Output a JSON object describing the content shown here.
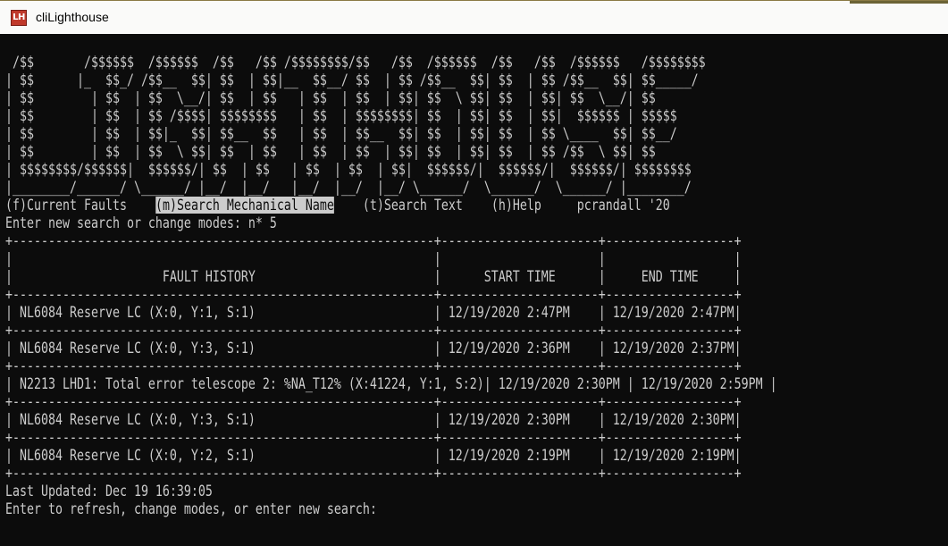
{
  "window": {
    "title": "cliLighthouse",
    "icon_label": "LH"
  },
  "banner": [
    " /$$       /$$$$$$  /$$$$$$  /$$   /$$ /$$$$$$$$/$$   /$$  /$$$$$$  /$$   /$$  /$$$$$$   /$$$$$$$$",
    "| $$      |_  $$_/ /$$__  $$| $$  | $$|__  $$__/ $$  | $$ /$$__  $$| $$  | $$ /$$__  $$| $$_____/",
    "| $$        | $$  | $$  \\__/| $$  | $$   | $$  | $$  | $$| $$  \\ $$| $$  | $$| $$  \\__/| $$",
    "| $$        | $$  | $$ /$$$$| $$$$$$$$   | $$  | $$$$$$$$| $$  | $$| $$  | $$|  $$$$$$ | $$$$$",
    "| $$        | $$  | $$|_  $$| $$__  $$   | $$  | $$__  $$| $$  | $$| $$  | $$ \\____  $$| $$__/",
    "| $$        | $$  | $$  \\ $$| $$  | $$   | $$  | $$  | $$| $$  | $$| $$  | $$ /$$  \\ $$| $$",
    "| $$$$$$$$/$$$$$$|  $$$$$$/| $$  | $$   | $$  | $$  | $$|  $$$$$$/|  $$$$$$/|  $$$$$$/| $$$$$$$$",
    "|________/______/ \\______/ |__/  |__/   |__/  |__/  |__/ \\______/  \\______/  \\______/ |________/"
  ],
  "menu": {
    "current_faults": "(f)Current Faults",
    "gap_1": "    ",
    "search_mechanical": "(m)Search Mechanical Name",
    "gap_2": "    ",
    "search_text": "(t)Search Text",
    "gap_3": "    ",
    "help": "(h)Help",
    "gap_4": "     ",
    "author": "pcrandall '20"
  },
  "prompt": {
    "label": "Enter new search or change modes: ",
    "value": "n* 5"
  },
  "table": {
    "border": "+-----------------------------------------------------------+----------------------+------------------+",
    "header_blank": "|                                                           |                      |                  |",
    "header_row": "|                     FAULT HISTORY                         |      START TIME      |     END TIME     |",
    "rows": [
      "| NL6084 Reserve LC (X:0, Y:1, S:1)                         | 12/19/2020 2:47PM    | 12/19/2020 2:47PM|",
      "| NL6084 Reserve LC (X:0, Y:3, S:1)                         | 12/19/2020 2:36PM    | 12/19/2020 2:37PM|",
      "| N2213 LHD1: Total error telescope 2: %NA_T12% (X:41224, Y:1, S:2)| 12/19/2020 2:30PM | 12/19/2020 2:59PM |",
      "| NL6084 Reserve LC (X:0, Y:3, S:1)                         | 12/19/2020 2:30PM    | 12/19/2020 2:30PM|",
      "| NL6084 Reserve LC (X:0, Y:2, S:1)                         | 12/19/2020 2:19PM    | 12/19/2020 2:19PM|"
    ]
  },
  "status": {
    "last_updated": "Last Updated: Dec 19 16:39:05",
    "refresh_prompt": "Enter to refresh, change modes, or enter new search:"
  }
}
